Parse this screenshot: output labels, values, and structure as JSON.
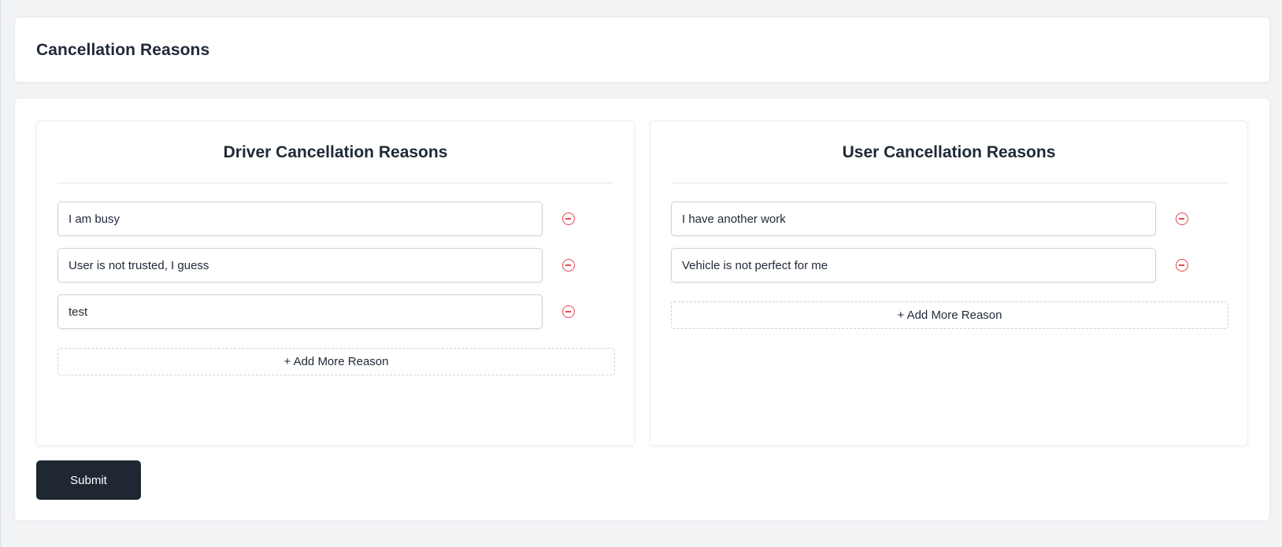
{
  "page": {
    "title": "Cancellation Reasons"
  },
  "driver": {
    "title": "Driver Cancellation Reasons",
    "reasons": [
      "I am busy",
      "User is not trusted, I guess",
      "test"
    ],
    "add_label": "+ Add More Reason"
  },
  "user": {
    "title": "User Cancellation Reasons",
    "reasons": [
      "I have another work",
      "Vehicle is not perfect for me"
    ],
    "add_label": "+ Add More Reason"
  },
  "actions": {
    "submit_label": "Submit"
  },
  "icons": {
    "remove": "minus-circle-icon"
  },
  "colors": {
    "remove": "#e5484d",
    "submit_bg": "#1f2832"
  }
}
